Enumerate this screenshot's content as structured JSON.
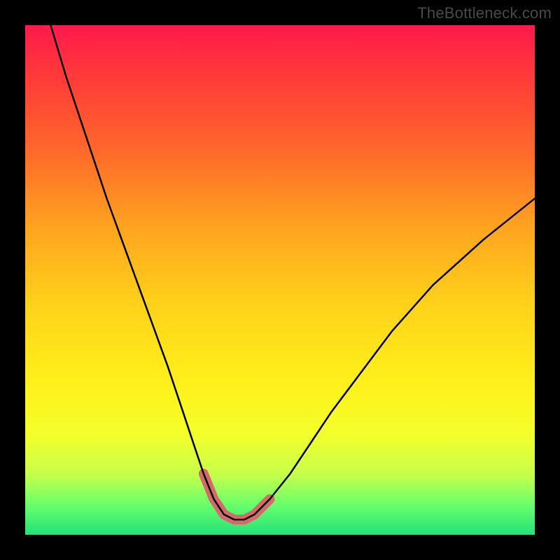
{
  "watermark": "TheBottleneck.com",
  "chart_data": {
    "type": "line",
    "title": "",
    "xlabel": "",
    "ylabel": "",
    "xlim": [
      0,
      100
    ],
    "ylim": [
      0,
      100
    ],
    "grid": false,
    "series": [
      {
        "name": "curve",
        "color": "#000000",
        "stroke_width": 2.5,
        "x": [
          5,
          8,
          12,
          16,
          20,
          24,
          28,
          31,
          33,
          35,
          37,
          39,
          41,
          43,
          45,
          48,
          52,
          56,
          60,
          66,
          72,
          80,
          90,
          100
        ],
        "y": [
          100,
          90,
          78,
          66,
          55,
          44,
          33,
          24,
          18,
          12,
          7,
          4,
          3,
          3,
          4,
          7,
          12,
          18,
          24,
          32,
          40,
          49,
          58,
          66
        ]
      },
      {
        "name": "highlight-trough",
        "color": "#d46a6a",
        "stroke_width": 14,
        "x": [
          35,
          37,
          39,
          41,
          43,
          45,
          48
        ],
        "y": [
          12,
          7,
          4,
          3,
          3,
          4,
          7
        ]
      }
    ]
  }
}
